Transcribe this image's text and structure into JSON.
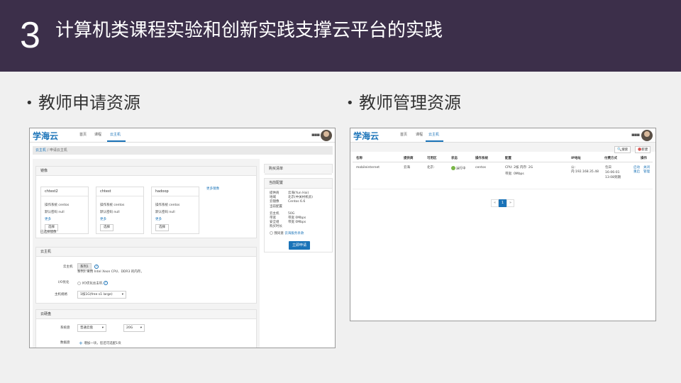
{
  "slide": {
    "number": "3",
    "title": "计算机类课程实验和创新实践支撑云平台的实践",
    "bullet_left": "教师申请资源",
    "bullet_right": "教师管理资源"
  },
  "app": {
    "logo": "学海云",
    "nav": [
      "首页",
      "课程",
      "云主机"
    ]
  },
  "apply": {
    "breadcrumb_link": "云主机",
    "breadcrumb_current": "申请云主机",
    "image_section": {
      "title": "镜像",
      "more": "更多镜像",
      "cards": [
        {
          "name": "chtest2",
          "os": "操作系统 centos",
          "pwd": "默认密码 null",
          "more": "更多",
          "btn": "选择"
        },
        {
          "name": "chtest",
          "os": "操作系统 centos",
          "pwd": "默认密码 null",
          "more": "更多",
          "btn": "选择"
        },
        {
          "name": "hadoop",
          "os": "操作系统 centos",
          "pwd": "默认密码 null",
          "more": "更多",
          "btn": "选择"
        }
      ],
      "selected_label": "已选择镜像"
    },
    "host_section": {
      "title": "云主机",
      "host_label": "云主机",
      "series_value": "系列1",
      "series_desc": "系列1 采用 Intel Xeon CPU、DDR3 的内存。",
      "io_label": "I/O优化",
      "io_value": "I/O优化云主机",
      "spec_label": "主机规格",
      "spec_value": "1核1G(free s1 large)"
    },
    "disk_section": {
      "title": "云硬盘",
      "sys_label": "系统盘",
      "sys_type": "普通云盘",
      "sys_size": "20G",
      "data_label": "数据盘",
      "data_add": "增加一块，您还可选配1块"
    },
    "cart": {
      "title": "购买清单",
      "config_title": "当前配置",
      "rows": [
        {
          "k": "提供商",
          "v": "云海(Yun Hai)"
        },
        {
          "k": "地域",
          "v": "北京(中关村机房)"
        },
        {
          "k": "云镜像",
          "v": "Centos 6.6"
        },
        {
          "k": "当前配置",
          "v": ""
        },
        {
          "k": "云主机",
          "v": "50G"
        },
        {
          "k": "带宽",
          "v": "带宽 0Mbps"
        },
        {
          "k": "安全组",
          "v": "带宽 0Mbps"
        },
        {
          "k": "购买时长",
          "v": ""
        }
      ],
      "agree_prefix": "我同意",
      "agree_link": "云海服务条款",
      "submit": "立即申请"
    }
  },
  "manage": {
    "search_btn": "搜索",
    "new_btn": "新建",
    "columns": [
      "名称",
      "提供商",
      "可用区",
      "状态",
      "操作系统",
      "配置",
      "IP地址",
      "付费方式",
      "操作"
    ],
    "row": {
      "name": "mobileinternet",
      "provider": "云海",
      "zone": "北京-",
      "status": "运行中",
      "os": "centos",
      "cpu": "CPU:   2核    内存:   2G",
      "bandwidth": "带宽:   0Mbps",
      "ip_pub": "公:",
      "ip_priv": "内:192.168.35.48",
      "pay_type": "包日",
      "pay_date": "16-06-01",
      "pay_expire": "13:08到期",
      "op_start": "启动",
      "op_stop": "关闭",
      "op_restart": "重启",
      "op_manage": "管理"
    },
    "pager": [
      "«",
      "1",
      "»"
    ]
  },
  "icons": {
    "grid": "apps-grid-icon",
    "avatar": "user-avatar",
    "search": "search-icon",
    "new": "plus-circle-icon"
  },
  "colors": {
    "header_bg": "#3c2f4a",
    "brand": "#1a73b8",
    "running": "#7ab648",
    "new_icon": "#d9534f"
  }
}
